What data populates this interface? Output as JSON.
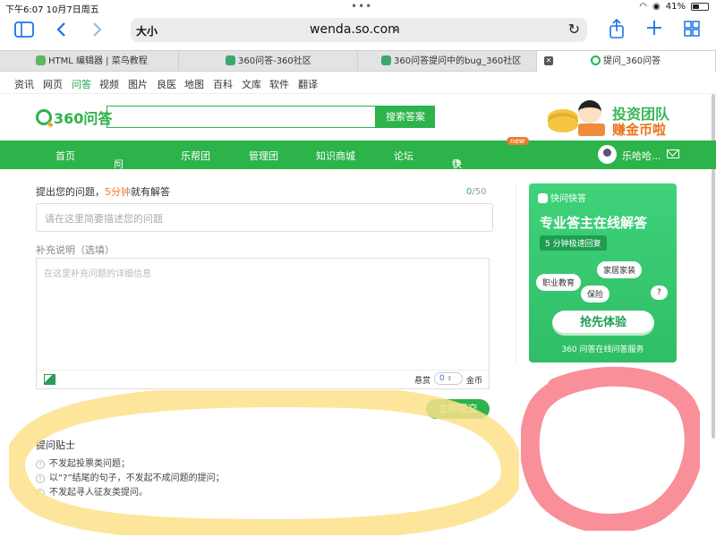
{
  "status": {
    "time": "下午6:07",
    "date": "10月7日周五",
    "battery": "41%"
  },
  "browser": {
    "text_size": "大小",
    "url": "wenda.so.com",
    "tabs": [
      {
        "label": "HTML 编辑器 | 菜鸟教程"
      },
      {
        "label": "360问答-360社区"
      },
      {
        "label": "360问答提问中的bug_360社区"
      },
      {
        "label": "提问_360问答"
      }
    ]
  },
  "site_nav": [
    "资讯",
    "网页",
    "问答",
    "视频",
    "图片",
    "良医",
    "地图",
    "百科",
    "文库",
    "软件",
    "翻译"
  ],
  "header": {
    "logo": "360问答",
    "search_button": "搜索答案",
    "banner_line1": "投资团队",
    "banner_line2": "赚金币啦"
  },
  "main_nav": {
    "items": [
      "首页",
      "问题库",
      "乐帮团",
      "管理团",
      "知识商城",
      "论坛",
      "快问快答"
    ],
    "new_badge": "new",
    "user": "乐哈哈..."
  },
  "form": {
    "title_prefix": "提出您的问题，",
    "title_highlight": "5分钟",
    "title_suffix": "就有解答",
    "counter_current": "0",
    "counter_max": "/50",
    "question_placeholder": "请在这里简要描述您的问题",
    "detail_label": "补充说明（选填）",
    "detail_placeholder": "在这里补充问题的详细信息",
    "reward_label": "悬赏",
    "reward_value": "0",
    "gold_label": "金币",
    "submit": "立即提交"
  },
  "tips": {
    "title": "提问贴士",
    "items": [
      "不发起投票类问题；",
      "以“?”结尾的句子，不发起不成问题的提问；",
      "不发起寻人征友类提问。"
    ]
  },
  "card": {
    "brand": "快问快答",
    "headline": "专业答主在线解答",
    "pill": "5 分钟极速回复",
    "bubbles": [
      "家居家装",
      "职业教育",
      "保险",
      "?"
    ],
    "cta": "抢先体验",
    "footer": "360 问答在线问答服务"
  },
  "colors": {
    "brand_green": "#2cb34a",
    "highlight_orange": "#f07b2c",
    "annotation_yellow": "#fde28a",
    "annotation_red": "#f77b87"
  }
}
